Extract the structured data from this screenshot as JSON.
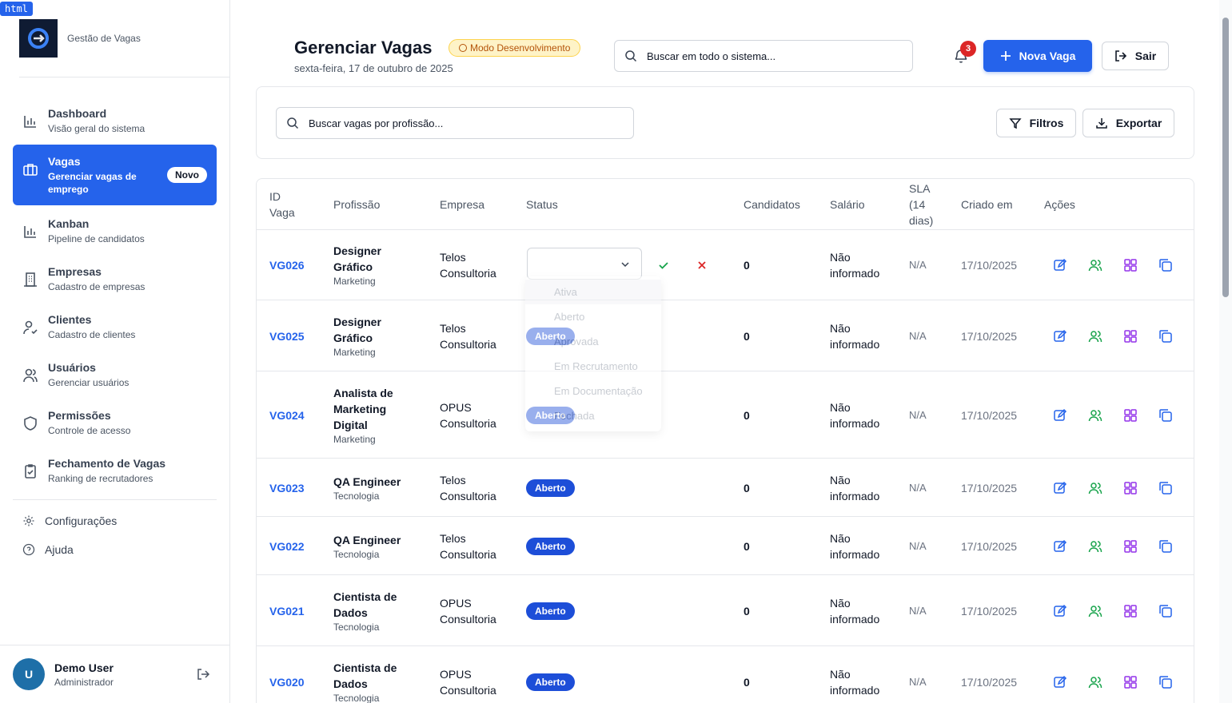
{
  "brand": {
    "name": "Gestão de Vagas"
  },
  "sidebar": {
    "items": [
      {
        "label": "Dashboard",
        "sub": "Visão geral do sistema",
        "icon": "bar-chart-icon"
      },
      {
        "label": "Vagas",
        "sub": "Gerenciar vagas de emprego",
        "icon": "briefcase-icon",
        "badge": "Novo",
        "active": true
      },
      {
        "label": "Kanban",
        "sub": "Pipeline de candidatos",
        "icon": "bar-chart-icon"
      },
      {
        "label": "Empresas",
        "sub": "Cadastro de empresas",
        "icon": "building-icon"
      },
      {
        "label": "Clientes",
        "sub": "Cadastro de clientes",
        "icon": "user-check-icon"
      },
      {
        "label": "Usuários",
        "sub": "Gerenciar usuários",
        "icon": "users-icon"
      },
      {
        "label": "Permissões",
        "sub": "Controle de acesso",
        "icon": "shield-icon"
      },
      {
        "label": "Fechamento de Vagas",
        "sub": "Ranking de recrutadores",
        "icon": "clipboard-check-icon"
      }
    ],
    "settings": "Configurações",
    "help": "Ajuda",
    "user": {
      "initial": "U",
      "name": "Demo User",
      "role": "Administrador"
    }
  },
  "header": {
    "title": "Gerenciar Vagas",
    "dev_badge": "Modo Desenvolvimento",
    "date": "sexta-feira, 17 de outubro de 2025",
    "search_placeholder": "Buscar em todo o sistema...",
    "notifications": "3",
    "new_button": "Nova Vaga",
    "logout_button": "Sair"
  },
  "filters": {
    "search_placeholder": "Buscar vagas por profissão...",
    "filters_button": "Filtros",
    "export_button": "Exportar"
  },
  "table": {
    "columns": [
      "ID\nVaga",
      "Profissão",
      "Empresa",
      "Status",
      "Candidatos",
      "Salário",
      "SLA\n(14\ndias)",
      "Criado em",
      "Ações"
    ],
    "rows": [
      {
        "id": "VG026",
        "profession": "Designer\nGráfico",
        "area": "Marketing",
        "company": "Telos\nConsultoria",
        "status": "",
        "candidates": "0",
        "salary": "Não\ninformado",
        "sla": "N/A",
        "created": "17/10/2025"
      },
      {
        "id": "VG025",
        "profession": "Designer\nGráfico",
        "area": "Marketing",
        "company": "Telos\nConsultoria",
        "status": "Aberto",
        "candidates": "0",
        "salary": "Não\ninformado",
        "sla": "N/A",
        "created": "17/10/2025"
      },
      {
        "id": "VG024",
        "profession": "Analista de\nMarketing\nDigital",
        "area": "Marketing",
        "company": "OPUS\nConsultoria",
        "status": "Aberto",
        "candidates": "0",
        "salary": "Não\ninformado",
        "sla": "N/A",
        "created": "17/10/2025"
      },
      {
        "id": "VG023",
        "profession": "QA Engineer",
        "area": "Tecnologia",
        "company": "Telos\nConsultoria",
        "status": "Aberto",
        "candidates": "0",
        "salary": "Não\ninformado",
        "sla": "N/A",
        "created": "17/10/2025"
      },
      {
        "id": "VG022",
        "profession": "QA Engineer",
        "area": "Tecnologia",
        "company": "Telos\nConsultoria",
        "status": "Aberto",
        "candidates": "0",
        "salary": "Não\ninformado",
        "sla": "N/A",
        "created": "17/10/2025"
      },
      {
        "id": "VG021",
        "profession": "Cientista de\nDados",
        "area": "Tecnologia",
        "company": "OPUS\nConsultoria",
        "status": "Aberto",
        "candidates": "0",
        "salary": "Não\ninformado",
        "sla": "N/A",
        "created": "17/10/2025"
      },
      {
        "id": "VG020",
        "profession": "Cientista de\nDados",
        "area": "Tecnologia",
        "company": "OPUS\nConsultoria",
        "status": "Aberto",
        "candidates": "0",
        "salary": "Não\ninformado",
        "sla": "N/A",
        "created": "17/10/2025"
      }
    ],
    "status_options": [
      "Ativa",
      "Aberto",
      "Aprovada",
      "Em Recrutamento",
      "Em Documentação",
      "Fechada"
    ]
  },
  "colors": {
    "primary": "#2563eb",
    "status_pill": "#1d4ed8",
    "confirm": "#16a34a",
    "cancel": "#dc2626",
    "candidates_icon": "#16a34a",
    "kanban_icon": "#9333ea",
    "edit_icon": "#2563eb"
  }
}
